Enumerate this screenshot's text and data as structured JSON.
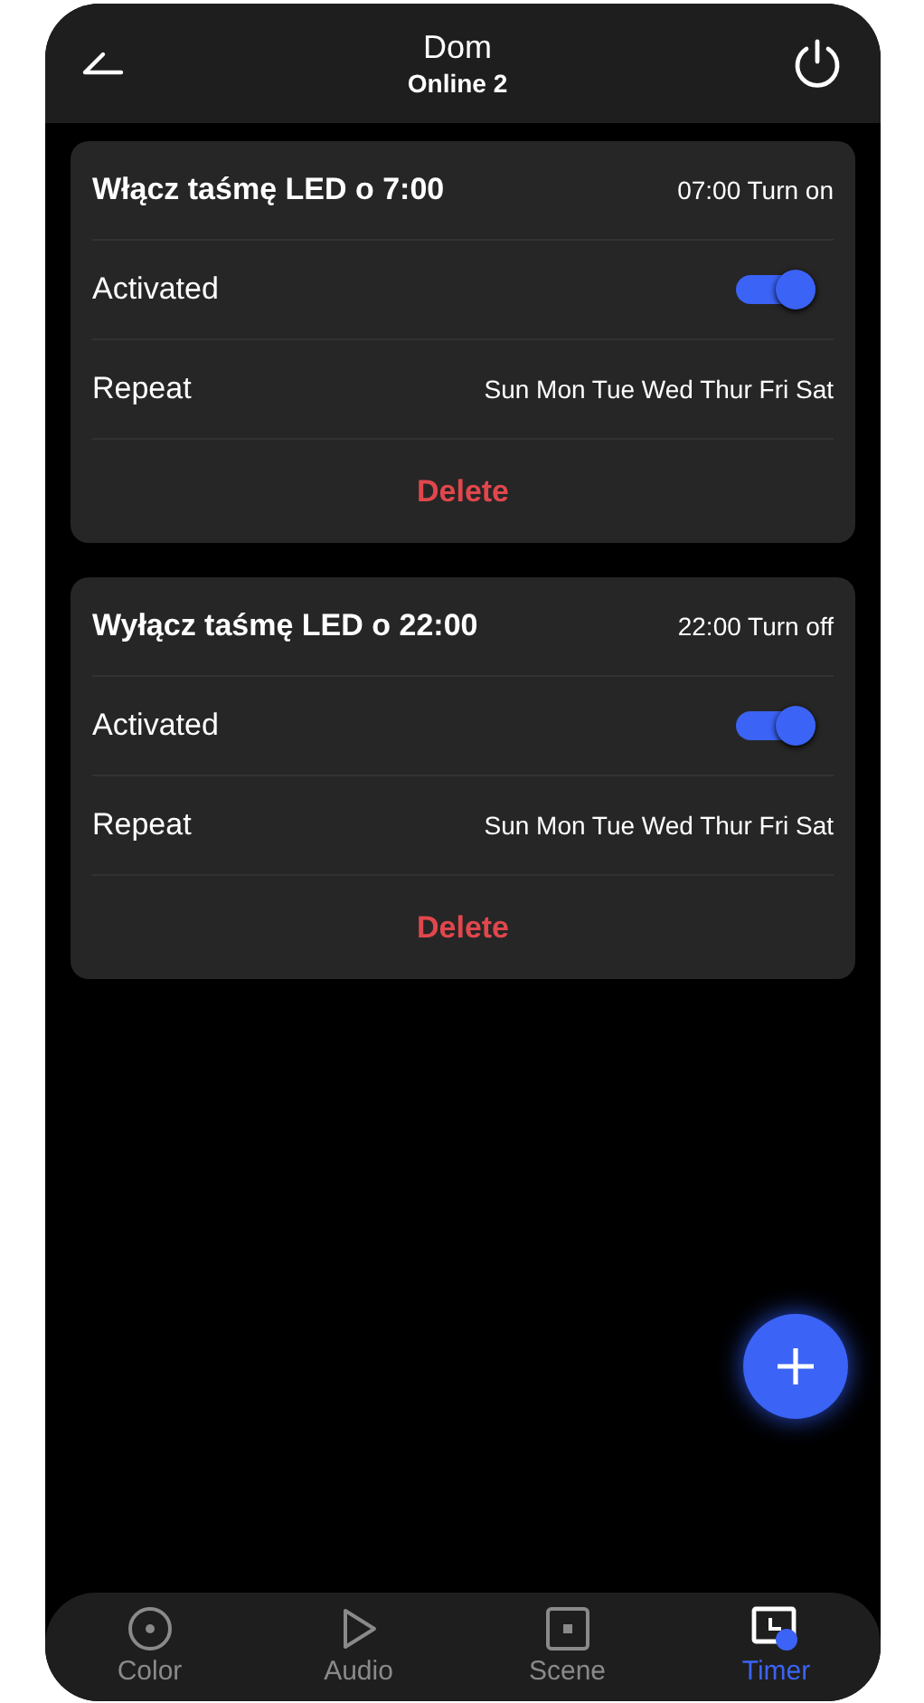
{
  "header": {
    "title": "Dom",
    "subtitle": "Online 2"
  },
  "timers": [
    {
      "name": "Włącz taśmę LED o 7:00",
      "summary": "07:00 Turn on",
      "activated_label": "Activated",
      "activated": true,
      "repeat_label": "Repeat",
      "repeat_days": "Sun Mon Tue Wed Thur Fri Sat",
      "delete_label": "Delete"
    },
    {
      "name": "Wyłącz taśmę LED o 22:00",
      "summary": "22:00 Turn off",
      "activated_label": "Activated",
      "activated": true,
      "repeat_label": "Repeat",
      "repeat_days": "Sun Mon Tue Wed Thur Fri Sat",
      "delete_label": "Delete"
    }
  ],
  "nav": [
    {
      "kind": "color",
      "label": "Color",
      "selected": false
    },
    {
      "kind": "audio",
      "label": "Audio",
      "selected": false
    },
    {
      "kind": "scene",
      "label": "Scene",
      "selected": false
    },
    {
      "kind": "timer",
      "label": "Timer",
      "selected": true
    }
  ]
}
